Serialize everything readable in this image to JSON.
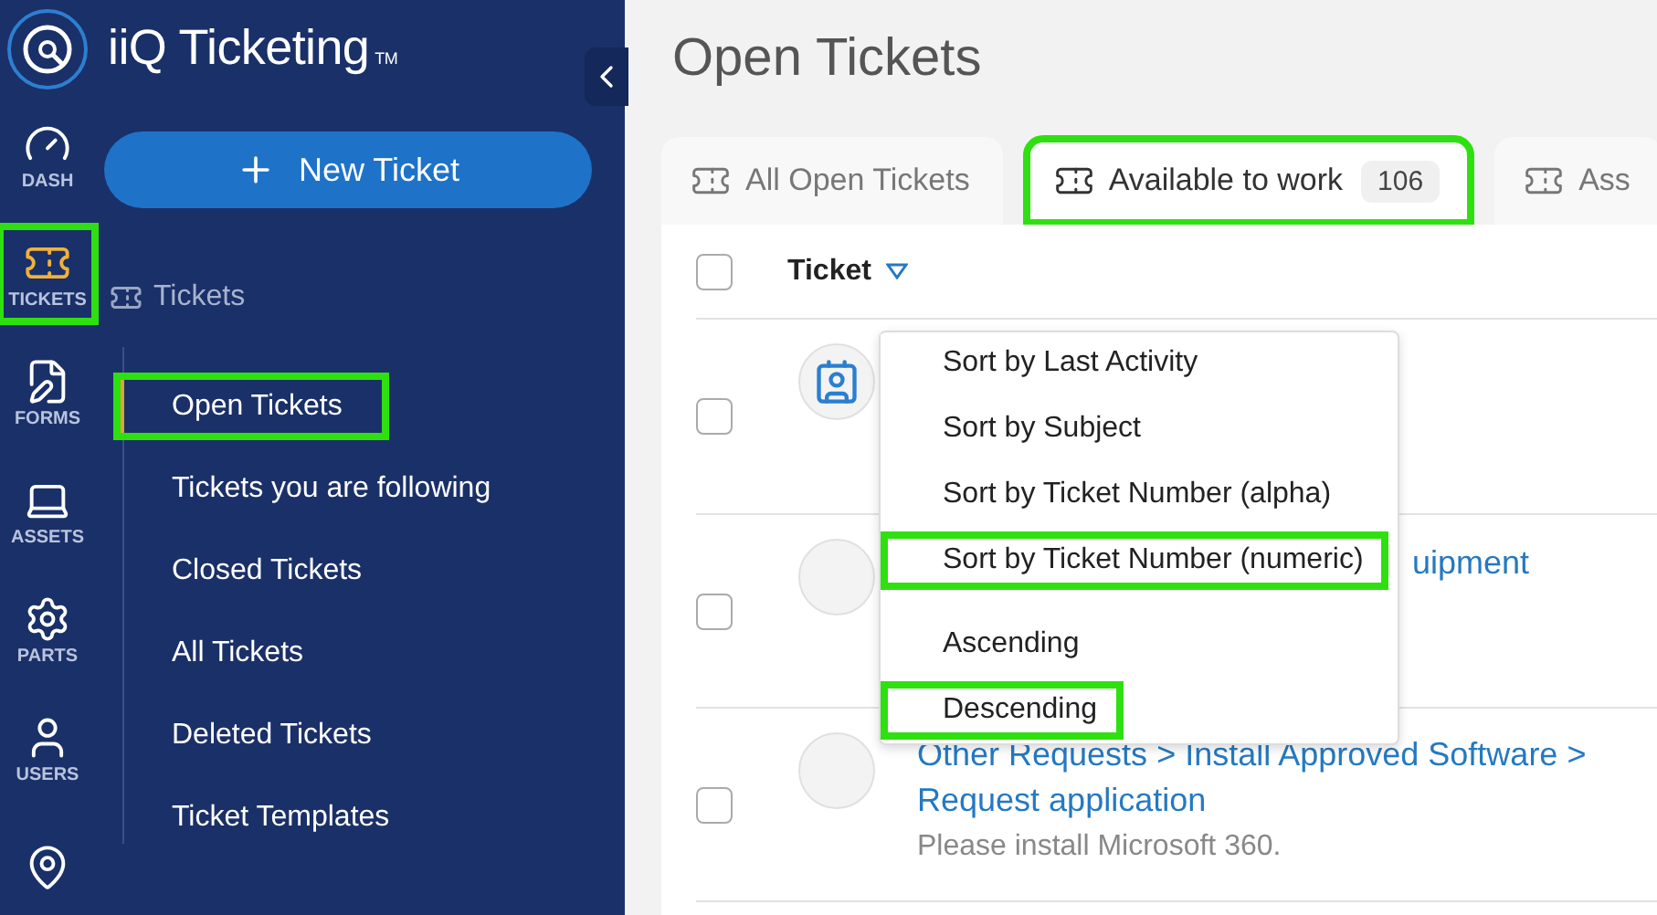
{
  "app": {
    "name": "iiQ Ticketing",
    "trademark": "TM"
  },
  "rail": [
    {
      "label": "DASH",
      "selected": false,
      "highlighted": false
    },
    {
      "label": "TICKETS",
      "selected": true,
      "highlighted": true
    },
    {
      "label": "FORMS",
      "selected": false,
      "highlighted": false
    },
    {
      "label": "ASSETS",
      "selected": false,
      "highlighted": false
    },
    {
      "label": "PARTS",
      "selected": false,
      "highlighted": false
    },
    {
      "label": "USERS",
      "selected": false,
      "highlighted": false
    },
    {
      "selected": false,
      "highlighted": false
    }
  ],
  "new_ticket_button": "New Ticket",
  "nav": {
    "header": "Tickets",
    "items": [
      {
        "label": "Open Tickets",
        "selected": true,
        "highlighted": true
      },
      {
        "label": "Tickets you are following",
        "selected": false,
        "highlighted": false
      },
      {
        "label": "Closed Tickets",
        "selected": false,
        "highlighted": false
      },
      {
        "label": "All Tickets",
        "selected": false,
        "highlighted": false
      },
      {
        "label": "Deleted Tickets",
        "selected": false,
        "highlighted": false
      },
      {
        "label": "Ticket Templates",
        "selected": false,
        "highlighted": false
      }
    ]
  },
  "page_title": "Open Tickets",
  "tabs": [
    {
      "label": "All Open Tickets",
      "selected": false,
      "highlighted": false
    },
    {
      "label": "Available to work",
      "count": "106",
      "selected": true,
      "highlighted": true
    },
    {
      "label": "Ass",
      "selected": false,
      "highlighted": false
    }
  ],
  "table": {
    "column": "Ticket",
    "header_checked": false,
    "rows": [
      {
        "checked": false
      },
      {
        "checked": false,
        "covered": true,
        "title": "uipment"
      },
      {
        "checked": false,
        "covered": false,
        "title": "Other Requests > Install Approved Software > Request application",
        "description": "Please install Microsoft 360."
      }
    ]
  },
  "sort_menu": {
    "groups": [
      [
        {
          "label": "Sort by Last Activity",
          "highlighted": false
        },
        {
          "label": "Sort by Subject",
          "highlighted": false
        },
        {
          "label": "Sort by Ticket Number (alpha)",
          "highlighted": false
        },
        {
          "label": "Sort by Ticket Number (numeric)",
          "highlighted": true
        }
      ],
      [
        {
          "label": "Ascending",
          "highlighted": false
        },
        {
          "label": "Descending",
          "highlighted": true
        }
      ]
    ]
  }
}
